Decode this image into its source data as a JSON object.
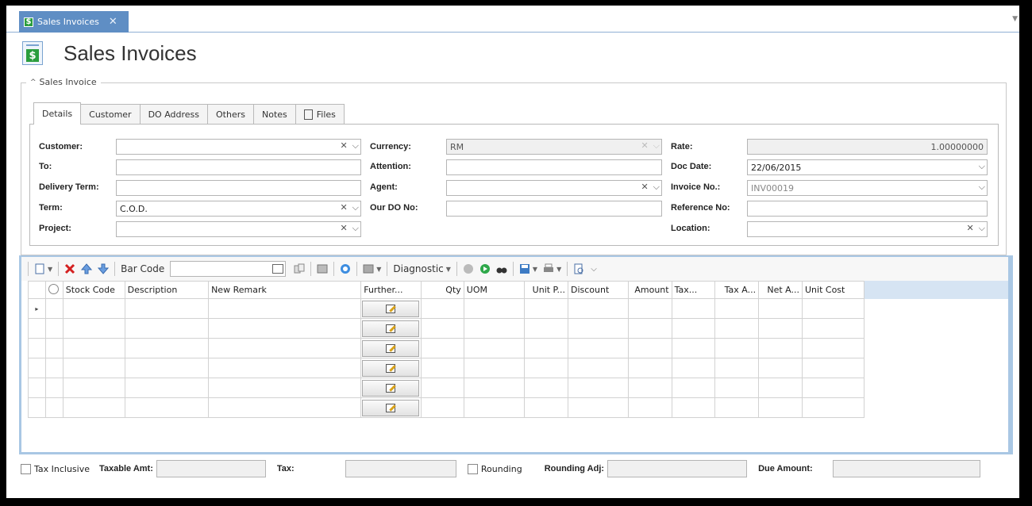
{
  "window": {
    "tab_label": "Sales Invoices",
    "tab_close": "✕",
    "page_title": "Sales Invoices",
    "app_icon_glyph": "$"
  },
  "group": {
    "legend": "Sales Invoice",
    "collapse_glyph": "^"
  },
  "tabs": [
    "Details",
    "Customer",
    "DO Address",
    "Others",
    "Notes",
    "Files"
  ],
  "active_tab": "Details",
  "form": {
    "customer_label": "Customer:",
    "customer_value": "",
    "to_label": "To:",
    "to_value": "",
    "delivery_term_label": "Delivery Term:",
    "delivery_term_value": "",
    "term_label": "Term:",
    "term_value": "C.O.D.",
    "project_label": "Project:",
    "project_value": "",
    "currency_label": "Currency:",
    "currency_value": "RM",
    "attention_label": "Attention:",
    "attention_value": "",
    "agent_label": "Agent:",
    "agent_value": "",
    "our_do_label": "Our DO No:",
    "our_do_value": "",
    "rate_label": "Rate:",
    "rate_value": "1.00000000",
    "doc_date_label": "Doc Date:",
    "doc_date_value": "22/06/2015",
    "invoice_no_label": "Invoice No.:",
    "invoice_no_value": "INV00019",
    "reference_no_label": "Reference No:",
    "reference_no_value": "",
    "location_label": "Location:",
    "location_value": ""
  },
  "toolbar": {
    "barcode_label": "Bar Code",
    "diagnostic_label": "Diagnostic"
  },
  "grid": {
    "columns": [
      "",
      "",
      "Stock Code",
      "Description",
      "New Remark",
      "Further...",
      "Qty",
      "UOM",
      "Unit P...",
      "Discount",
      "Amount",
      "Tax...",
      "Tax A...",
      "Net A...",
      "Unit Cost"
    ],
    "row_count": 6,
    "row_indicator": "▸"
  },
  "footer": {
    "tax_inclusive_label": "Tax Inclusive",
    "taxable_amt_label": "Taxable Amt:",
    "tax_label": "Tax:",
    "rounding_label": "Rounding",
    "rounding_adj_label": "Rounding Adj:",
    "due_amount_label": "Due Amount:"
  },
  "colors": {
    "accent": "#5f8ec4",
    "grid_frame": "#a9c7e4",
    "money_green": "#2a9d3d",
    "delete_red": "#d42020"
  }
}
